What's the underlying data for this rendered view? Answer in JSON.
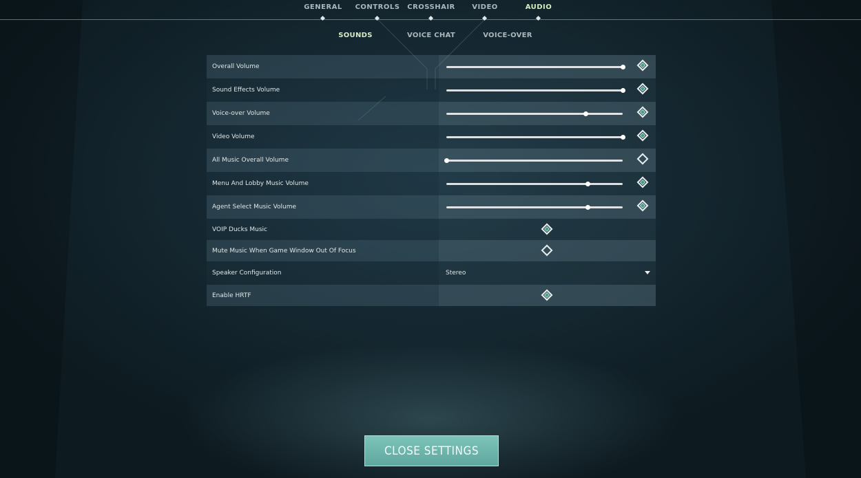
{
  "tabs": [
    {
      "label": "GENERAL",
      "active": false
    },
    {
      "label": "CONTROLS",
      "active": false
    },
    {
      "label": "CROSSHAIR",
      "active": false
    },
    {
      "label": "VIDEO",
      "active": false
    },
    {
      "label": "AUDIO",
      "active": true
    }
  ],
  "subtabs": [
    {
      "label": "SOUNDS",
      "active": true
    },
    {
      "label": "VOICE CHAT",
      "active": false
    },
    {
      "label": "VOICE-OVER",
      "active": false
    }
  ],
  "settings": [
    {
      "label": "Overall Volume",
      "type": "slider",
      "value": 1.0,
      "reset_filled": true
    },
    {
      "label": "Sound Effects Volume",
      "type": "slider",
      "value": 1.0,
      "reset_filled": true
    },
    {
      "label": "Voice-over Volume",
      "type": "slider",
      "value": 0.79,
      "reset_filled": true
    },
    {
      "label": "Video Volume",
      "type": "slider",
      "value": 1.0,
      "reset_filled": true
    },
    {
      "label": "All Music Overall Volume",
      "type": "slider",
      "value": 0.0,
      "reset_filled": false
    },
    {
      "label": "Menu And Lobby Music Volume",
      "type": "slider",
      "value": 0.8,
      "reset_filled": true
    },
    {
      "label": "Agent Select Music Volume",
      "type": "slider",
      "value": 0.8,
      "reset_filled": true
    },
    {
      "label": "VOIP Ducks Music",
      "type": "checkbox",
      "checked": true
    },
    {
      "label": "Mute Music When Game Window Out Of Focus",
      "type": "checkbox",
      "checked": false
    },
    {
      "label": "Speaker Configuration",
      "type": "dropdown",
      "value": "Stereo"
    },
    {
      "label": "Enable HRTF",
      "type": "checkbox",
      "checked": true
    }
  ],
  "close_button": {
    "label": "CLOSE SETTINGS"
  },
  "colors": {
    "accent": "#6fb8ae",
    "active_tab": "#d8ecc4",
    "check_fill": "#3f9e89"
  }
}
